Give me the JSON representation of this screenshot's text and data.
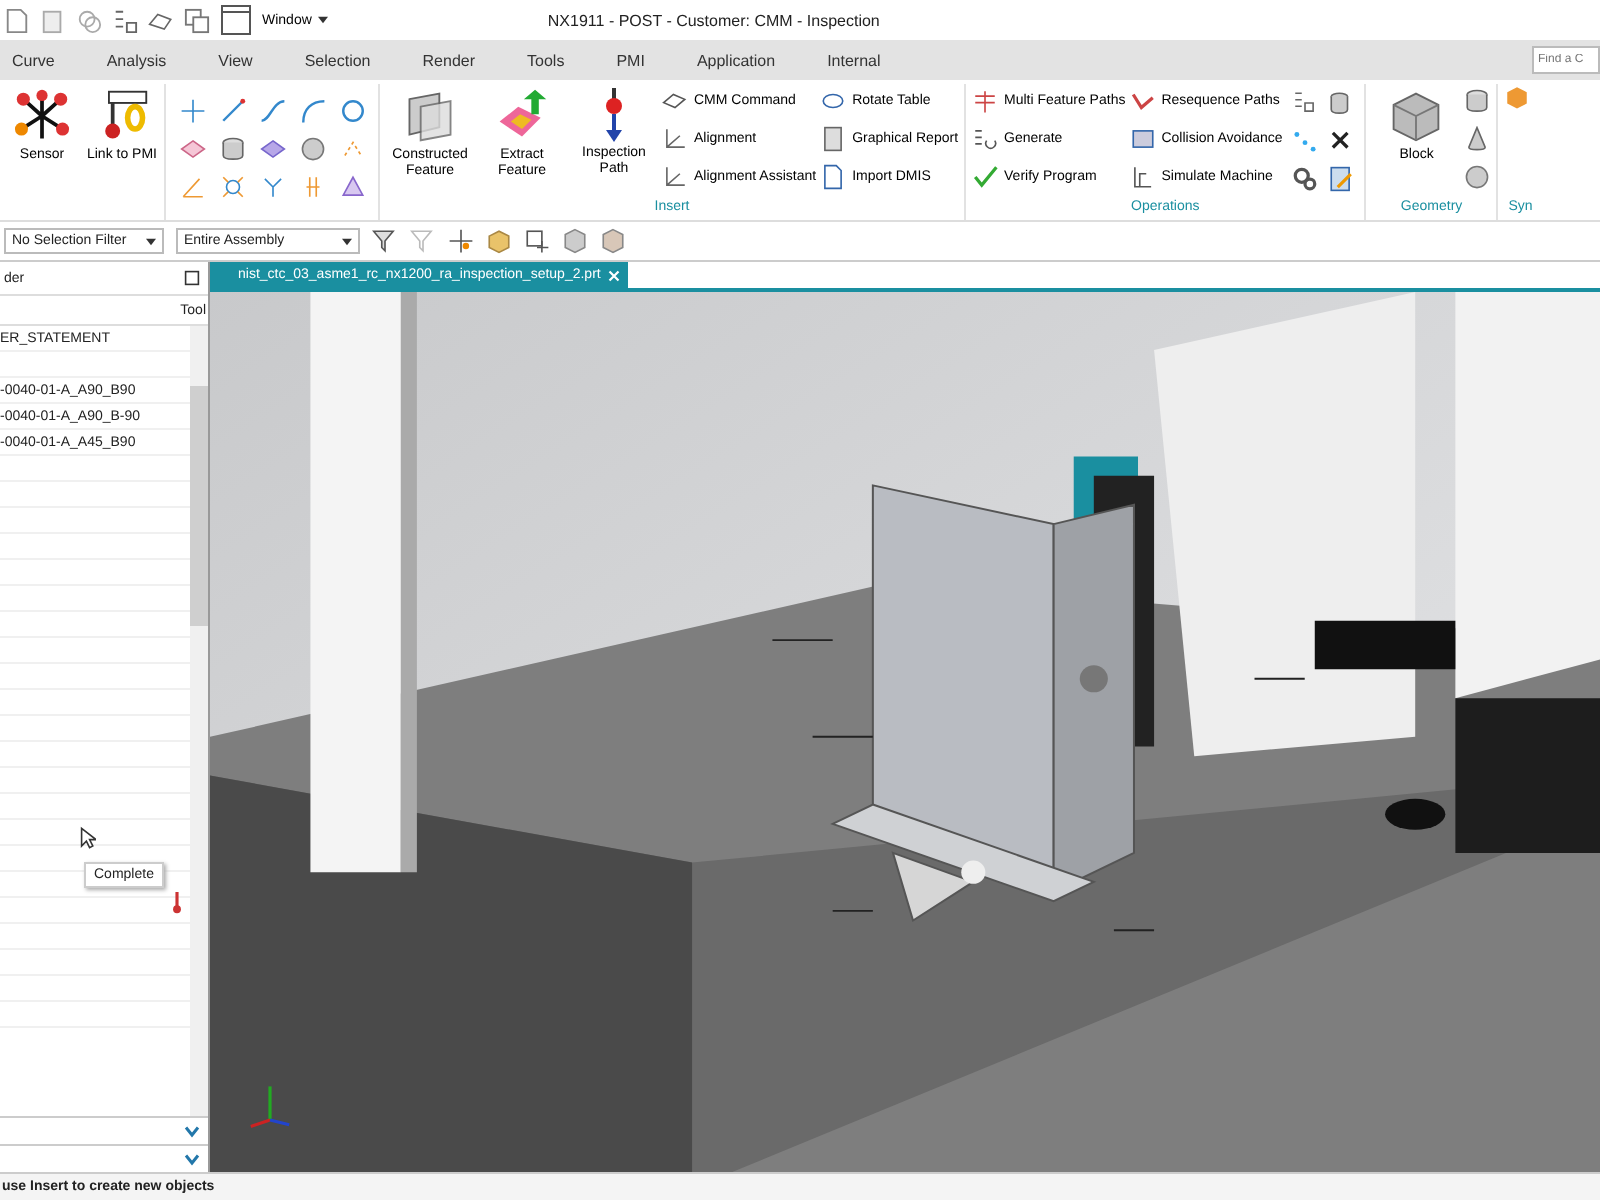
{
  "quick_access": {
    "window_menu": "Window"
  },
  "window_title": "NX1911 - POST - Customer: CMM - Inspection",
  "menu_tabs": [
    {
      "label": "Curve",
      "selected": false
    },
    {
      "label": "Analysis",
      "selected": false
    },
    {
      "label": "View",
      "selected": false
    },
    {
      "label": "Selection",
      "selected": false
    },
    {
      "label": "Render",
      "selected": false
    },
    {
      "label": "Tools",
      "selected": false
    },
    {
      "label": "PMI",
      "selected": false
    },
    {
      "label": "Application",
      "selected": false
    },
    {
      "label": "Internal",
      "selected": false
    }
  ],
  "command_search": {
    "placeholder": "Find a C"
  },
  "ribbon": {
    "first_group": [
      {
        "label": "Sensor"
      },
      {
        "label": "Link to PMI"
      }
    ],
    "insert": {
      "label": "Insert",
      "large": [
        {
          "label": "Constructed Feature"
        },
        {
          "label": "Extract Feature"
        },
        {
          "label": "Inspection Path"
        }
      ],
      "small": [
        {
          "label": "CMM Command"
        },
        {
          "label": "Alignment"
        },
        {
          "label": "Alignment Assistant"
        },
        {
          "label": "Rotate Table"
        },
        {
          "label": "Graphical Report"
        },
        {
          "label": "Import DMIS"
        }
      ]
    },
    "operations": {
      "label": "Operations",
      "small": [
        {
          "label": "Multi Feature Paths"
        },
        {
          "label": "Generate"
        },
        {
          "label": "Verify Program"
        },
        {
          "label": "Resequence Paths"
        },
        {
          "label": "Collision Avoidance"
        },
        {
          "label": "Simulate Machine"
        }
      ]
    },
    "geometry": {
      "label": "Geometry",
      "large": [
        {
          "label": "Block"
        }
      ]
    },
    "next_group": {
      "label": "Syn"
    }
  },
  "filter_bar": {
    "selection_filter": "No Selection Filter",
    "scope": "Entire Assembly"
  },
  "navigator": {
    "title": "der",
    "column": "Tool",
    "rows": [
      "ER_STATEMENT",
      "",
      "-0040-01-A_A90_B90",
      "-0040-01-A_A90_B-90",
      "-0040-01-A_A45_B90"
    ],
    "tooltip": "Complete"
  },
  "document_tab": {
    "label": "nist_ctc_03_asme1_rc_nx1200_ra_inspection_setup_2.prt"
  },
  "status_bar": {
    "message": "use Insert to create new objects"
  }
}
